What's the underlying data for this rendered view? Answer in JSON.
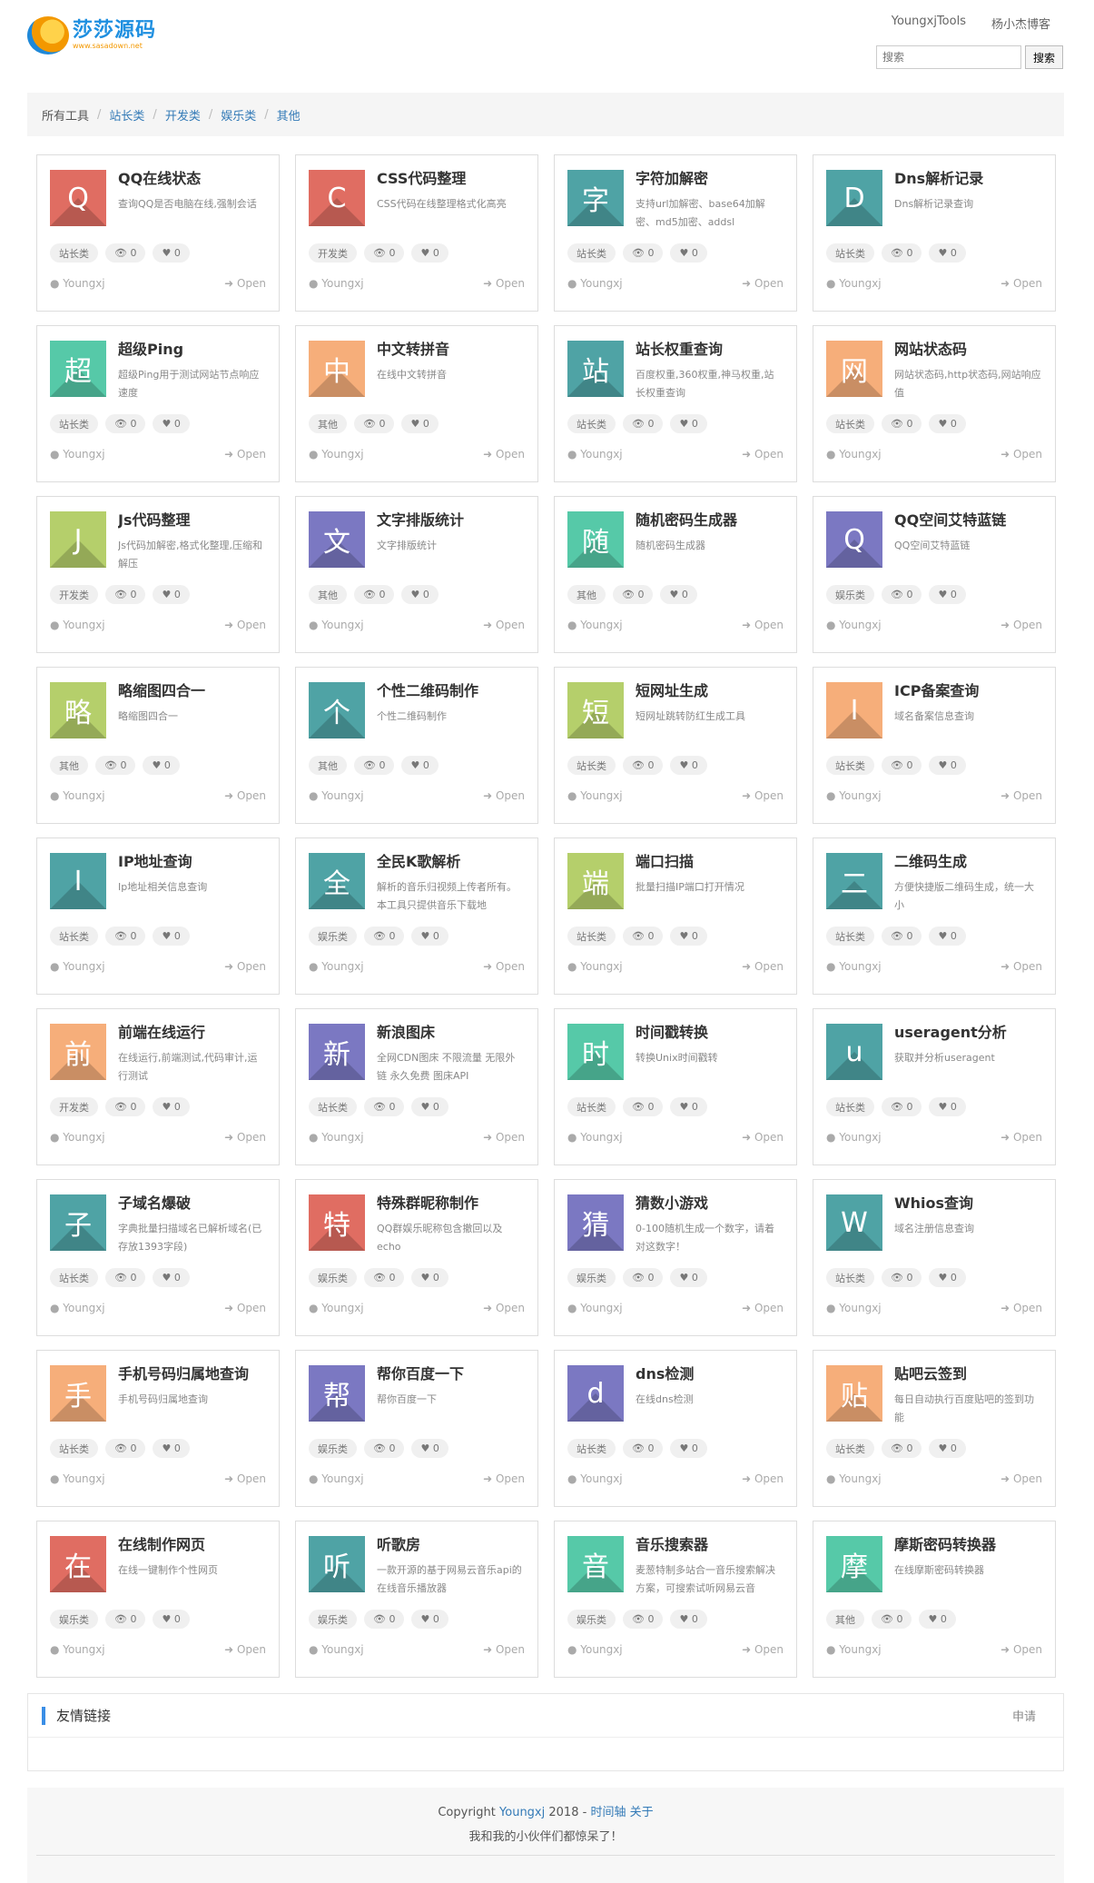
{
  "header": {
    "logo_name": "莎莎源码",
    "logo_url": "www.sasadown.net",
    "nav": [
      "YoungxjTools",
      "杨小杰博客"
    ],
    "search_placeholder": "搜索",
    "search_button": "搜索"
  },
  "breadcrumb": [
    "所有工具",
    "站长类",
    "开发类",
    "娱乐类",
    "其他"
  ],
  "tools": [
    {
      "letter": "Q",
      "title": "QQ在线状态",
      "desc": "查询QQ是否电脑在线,强制会话",
      "tag": "站长类",
      "views": "0",
      "likes": "0",
      "author": "Youngxj",
      "open": "Open",
      "color": "#e06d62"
    },
    {
      "letter": "C",
      "title": "CSS代码整理",
      "desc": "CSS代码在线整理格式化高亮",
      "tag": "开发类",
      "views": "0",
      "likes": "0",
      "author": "Youngxj",
      "open": "Open",
      "color": "#e06d62"
    },
    {
      "letter": "字",
      "title": "字符加解密",
      "desc": "支持url加解密、base64加解密、md5加密、addsl",
      "tag": "站长类",
      "views": "0",
      "likes": "0",
      "author": "Youngxj",
      "open": "Open",
      "color": "#4fa3a5"
    },
    {
      "letter": "D",
      "title": "Dns解析记录",
      "desc": "Dns解析记录查询",
      "tag": "站长类",
      "views": "0",
      "likes": "0",
      "author": "Youngxj",
      "open": "Open",
      "color": "#4fa3a5"
    },
    {
      "letter": "超",
      "title": "超级Ping",
      "desc": "超级Ping用于测试网站节点响应速度",
      "tag": "站长类",
      "views": "0",
      "likes": "0",
      "author": "Youngxj",
      "open": "Open",
      "color": "#56c9a8"
    },
    {
      "letter": "中",
      "title": "中文转拼音",
      "desc": "在线中文转拼音",
      "tag": "其他",
      "views": "0",
      "likes": "0",
      "author": "Youngxj",
      "open": "Open",
      "color": "#f6ae7a"
    },
    {
      "letter": "站",
      "title": "站长权重查询",
      "desc": "百度权重,360权重,神马权重,站长权重查询",
      "tag": "站长类",
      "views": "0",
      "likes": "0",
      "author": "Youngxj",
      "open": "Open",
      "color": "#4fa3a5"
    },
    {
      "letter": "网",
      "title": "网站状态码",
      "desc": "网站状态码,http状态码,网站响应值",
      "tag": "站长类",
      "views": "0",
      "likes": "0",
      "author": "Youngxj",
      "open": "Open",
      "color": "#f6ae7a"
    },
    {
      "letter": "J",
      "title": "Js代码整理",
      "desc": "Js代码加解密,格式化整理,压缩和解压",
      "tag": "开发类",
      "views": "0",
      "likes": "0",
      "author": "Youngxj",
      "open": "Open",
      "color": "#b5cf6b"
    },
    {
      "letter": "文",
      "title": "文字排版统计",
      "desc": "文字排版统计",
      "tag": "其他",
      "views": "0",
      "likes": "0",
      "author": "Youngxj",
      "open": "Open",
      "color": "#7b78c2"
    },
    {
      "letter": "随",
      "title": "随机密码生成器",
      "desc": "随机密码生成器",
      "tag": "其他",
      "views": "0",
      "likes": "0",
      "author": "Youngxj",
      "open": "Open",
      "color": "#56c9a8"
    },
    {
      "letter": "Q",
      "title": "QQ空间艾特蓝链",
      "desc": "QQ空间艾特蓝链",
      "tag": "娱乐类",
      "views": "0",
      "likes": "0",
      "author": "Youngxj",
      "open": "Open",
      "color": "#7b78c2"
    },
    {
      "letter": "略",
      "title": "略缩图四合一",
      "desc": "略缩图四合一",
      "tag": "其他",
      "views": "0",
      "likes": "0",
      "author": "Youngxj",
      "open": "Open",
      "color": "#b5cf6b"
    },
    {
      "letter": "个",
      "title": "个性二维码制作",
      "desc": "个性二维码制作",
      "tag": "其他",
      "views": "0",
      "likes": "0",
      "author": "Youngxj",
      "open": "Open",
      "color": "#4fa3a5"
    },
    {
      "letter": "短",
      "title": "短网址生成",
      "desc": "短网址跳转防红生成工具",
      "tag": "站长类",
      "views": "0",
      "likes": "0",
      "author": "Youngxj",
      "open": "Open",
      "color": "#b5cf6b"
    },
    {
      "letter": "I",
      "title": "ICP备案查询",
      "desc": "域名备案信息查询",
      "tag": "站长类",
      "views": "0",
      "likes": "0",
      "author": "Youngxj",
      "open": "Open",
      "color": "#f6ae7a"
    },
    {
      "letter": "I",
      "title": "IP地址查询",
      "desc": "Ip地址相关信息查询",
      "tag": "站长类",
      "views": "0",
      "likes": "0",
      "author": "Youngxj",
      "open": "Open",
      "color": "#4fa3a5"
    },
    {
      "letter": "全",
      "title": "全民K歌解析",
      "desc": "解析的音乐归视频上传者所有。本工具只提供音乐下载地",
      "tag": "娱乐类",
      "views": "0",
      "likes": "0",
      "author": "Youngxj",
      "open": "Open",
      "color": "#4fa3a5"
    },
    {
      "letter": "端",
      "title": "端口扫描",
      "desc": "批量扫描IP端口打开情况",
      "tag": "站长类",
      "views": "0",
      "likes": "0",
      "author": "Youngxj",
      "open": "Open",
      "color": "#b5cf6b"
    },
    {
      "letter": "二",
      "title": "二维码生成",
      "desc": "方便快捷版二维码生成，统一大小",
      "tag": "站长类",
      "views": "0",
      "likes": "0",
      "author": "Youngxj",
      "open": "Open",
      "color": "#4fa3a5"
    },
    {
      "letter": "前",
      "title": "前端在线运行",
      "desc": "在线运行,前端测试,代码审计,运行测试",
      "tag": "开发类",
      "views": "0",
      "likes": "0",
      "author": "Youngxj",
      "open": "Open",
      "color": "#f6ae7a"
    },
    {
      "letter": "新",
      "title": "新浪图床",
      "desc": "全网CDN图床 不限流量 无限外链 永久免费 图床API",
      "tag": "站长类",
      "views": "0",
      "likes": "0",
      "author": "Youngxj",
      "open": "Open",
      "color": "#7b78c2"
    },
    {
      "letter": "时",
      "title": "时间戳转换",
      "desc": "转换Unix时间戳转",
      "tag": "站长类",
      "views": "0",
      "likes": "0",
      "author": "Youngxj",
      "open": "Open",
      "color": "#56c9a8"
    },
    {
      "letter": "u",
      "title": "useragent分析",
      "desc": "获取并分析useragent",
      "tag": "站长类",
      "views": "0",
      "likes": "0",
      "author": "Youngxj",
      "open": "Open",
      "color": "#4fa3a5"
    },
    {
      "letter": "子",
      "title": "子域名爆破",
      "desc": "字典批量扫描域名已解析域名(已存放1393字段)",
      "tag": "站长类",
      "views": "0",
      "likes": "0",
      "author": "Youngxj",
      "open": "Open",
      "color": "#4fa3a5"
    },
    {
      "letter": "特",
      "title": "特殊群昵称制作",
      "desc": "QQ群娱乐昵称包含撤回以及echo",
      "tag": "娱乐类",
      "views": "0",
      "likes": "0",
      "author": "Youngxj",
      "open": "Open",
      "color": "#e06d62"
    },
    {
      "letter": "猜",
      "title": "猜数小游戏",
      "desc": "0-100随机生成一个数字，请着对这数字！",
      "tag": "娱乐类",
      "views": "0",
      "likes": "0",
      "author": "Youngxj",
      "open": "Open",
      "color": "#7b78c2"
    },
    {
      "letter": "W",
      "title": "Whios查询",
      "desc": "域名注册信息查询",
      "tag": "站长类",
      "views": "0",
      "likes": "0",
      "author": "Youngxj",
      "open": "Open",
      "color": "#4fa3a5"
    },
    {
      "letter": "手",
      "title": "手机号码归属地查询",
      "desc": "手机号码归属地查询",
      "tag": "站长类",
      "views": "0",
      "likes": "0",
      "author": "Youngxj",
      "open": "Open",
      "color": "#f6ae7a"
    },
    {
      "letter": "帮",
      "title": "帮你百度一下",
      "desc": "帮你百度一下",
      "tag": "娱乐类",
      "views": "0",
      "likes": "0",
      "author": "Youngxj",
      "open": "Open",
      "color": "#7b78c2"
    },
    {
      "letter": "d",
      "title": "dns检测",
      "desc": "在线dns检测",
      "tag": "站长类",
      "views": "0",
      "likes": "0",
      "author": "Youngxj",
      "open": "Open",
      "color": "#7b78c2"
    },
    {
      "letter": "贴",
      "title": "贴吧云签到",
      "desc": "每日自动执行百度贴吧的签到功能",
      "tag": "站长类",
      "views": "0",
      "likes": "0",
      "author": "Youngxj",
      "open": "Open",
      "color": "#f6ae7a"
    },
    {
      "letter": "在",
      "title": "在线制作网页",
      "desc": "在线一键制作个性网页",
      "tag": "娱乐类",
      "views": "0",
      "likes": "0",
      "author": "Youngxj",
      "open": "Open",
      "color": "#e06d62"
    },
    {
      "letter": "听",
      "title": "听歌房",
      "desc": "一款开源的基于网易云音乐api的在线音乐播放器",
      "tag": "娱乐类",
      "views": "0",
      "likes": "0",
      "author": "Youngxj",
      "open": "Open",
      "color": "#4fa3a5"
    },
    {
      "letter": "音",
      "title": "音乐搜索器",
      "desc": "麦葱特制多站合一音乐搜索解决方案，可搜索试听网易云音",
      "tag": "娱乐类",
      "views": "0",
      "likes": "0",
      "author": "Youngxj",
      "open": "Open",
      "color": "#56c9a8"
    },
    {
      "letter": "摩",
      "title": "摩斯密码转换器",
      "desc": "在线摩斯密码转换器",
      "tag": "其他",
      "views": "0",
      "likes": "0",
      "author": "Youngxj",
      "open": "Open",
      "color": "#56c9a8"
    }
  ],
  "icons": {
    "views": "eye-icon",
    "likes": "heart-icon",
    "author": "user-icon",
    "open": "sign-in-icon"
  },
  "links": {
    "title": "友情链接",
    "apply": "申请"
  },
  "footer": {
    "copyright": "Copyright",
    "author": "Youngxj",
    "year": "2018 -",
    "timeline": "时间轴",
    "about": "关于",
    "tagline": "我和我的小伙伴们都惊呆了！"
  }
}
